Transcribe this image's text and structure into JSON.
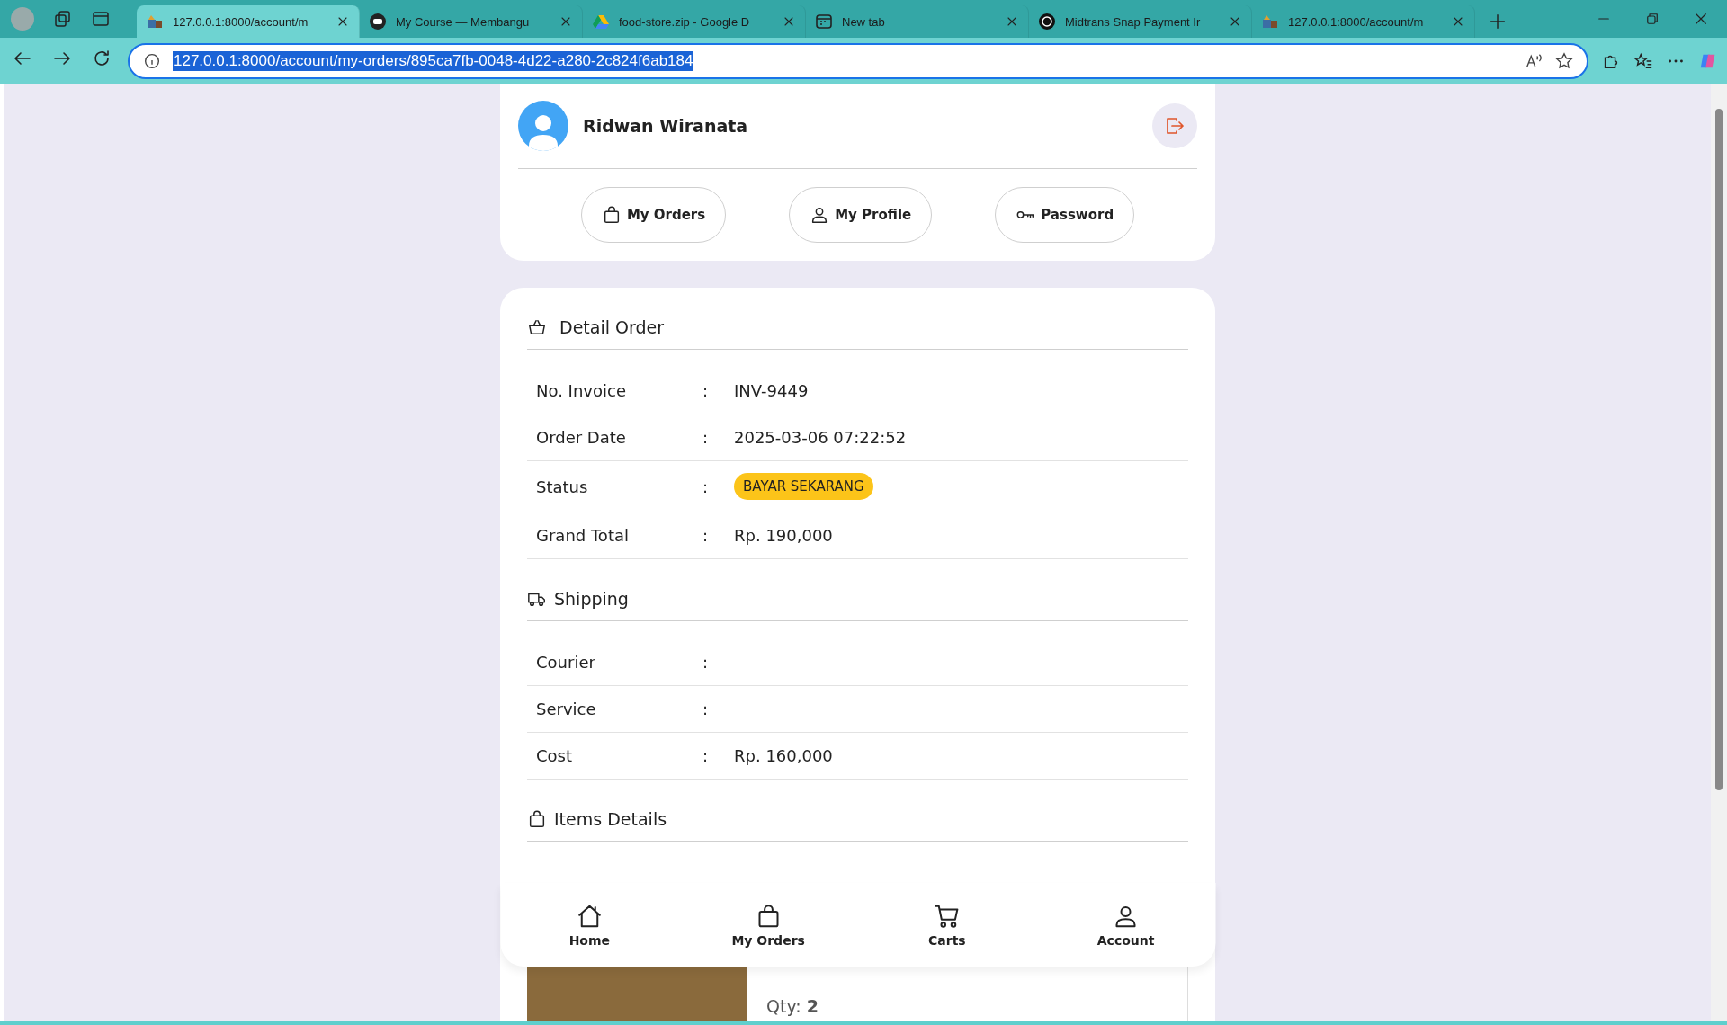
{
  "browser": {
    "tabs": [
      {
        "title": "127.0.0.1:8000/account/m",
        "kind": "shop",
        "selected": true
      },
      {
        "title": "My Course — Membangu",
        "kind": "mask",
        "selected": false
      },
      {
        "title": "food-store.zip - Google D",
        "kind": "drive",
        "selected": false
      },
      {
        "title": "New tab",
        "kind": "newtab",
        "selected": false
      },
      {
        "title": "Midtrans Snap Payment Ir",
        "kind": "knot",
        "selected": false
      },
      {
        "title": "127.0.0.1:8000/account/m",
        "kind": "shop",
        "selected": false
      }
    ],
    "url": "127.0.0.1:8000/account/my-orders/895ca7fb-0048-4d22-a280-2c824f6ab184"
  },
  "user": {
    "name": "Ridwan Wiranata"
  },
  "account_nav": [
    {
      "label": "My Orders",
      "kind": "bag"
    },
    {
      "label": "My Profile",
      "kind": "person"
    },
    {
      "label": "Password",
      "kind": "key"
    }
  ],
  "sections": [
    {
      "title": "Detail Order",
      "kind": "basket",
      "rows": [
        {
          "label": "No. Invoice",
          "colon": ":",
          "value": "INV-9449"
        },
        {
          "label": "Order Date",
          "colon": ":",
          "value": "2025-03-06 07:22:52"
        },
        {
          "label": "Status",
          "colon": ":",
          "badge": "BAYAR SEKARANG"
        },
        {
          "label": "Grand Total",
          "colon": ":",
          "value": "Rp. 190,000"
        }
      ]
    },
    {
      "title": "Shipping",
      "kind": "truck",
      "rows": [
        {
          "label": "Courier",
          "colon": ":"
        },
        {
          "label": "Service",
          "colon": ":"
        },
        {
          "label": "Cost",
          "colon": ":",
          "value": "Rp. 160,000"
        }
      ]
    },
    {
      "title": "Items Details",
      "kind": "bag"
    }
  ],
  "items": [
    {
      "qty": "Qty: **2**"
    }
  ],
  "bottom_nav": [
    {
      "label": "Home",
      "kind": "home"
    },
    {
      "label": "My Orders",
      "kind": "bag"
    },
    {
      "label": "Carts",
      "kind": "cart"
    },
    {
      "label": "Account",
      "kind": "person"
    }
  ]
}
